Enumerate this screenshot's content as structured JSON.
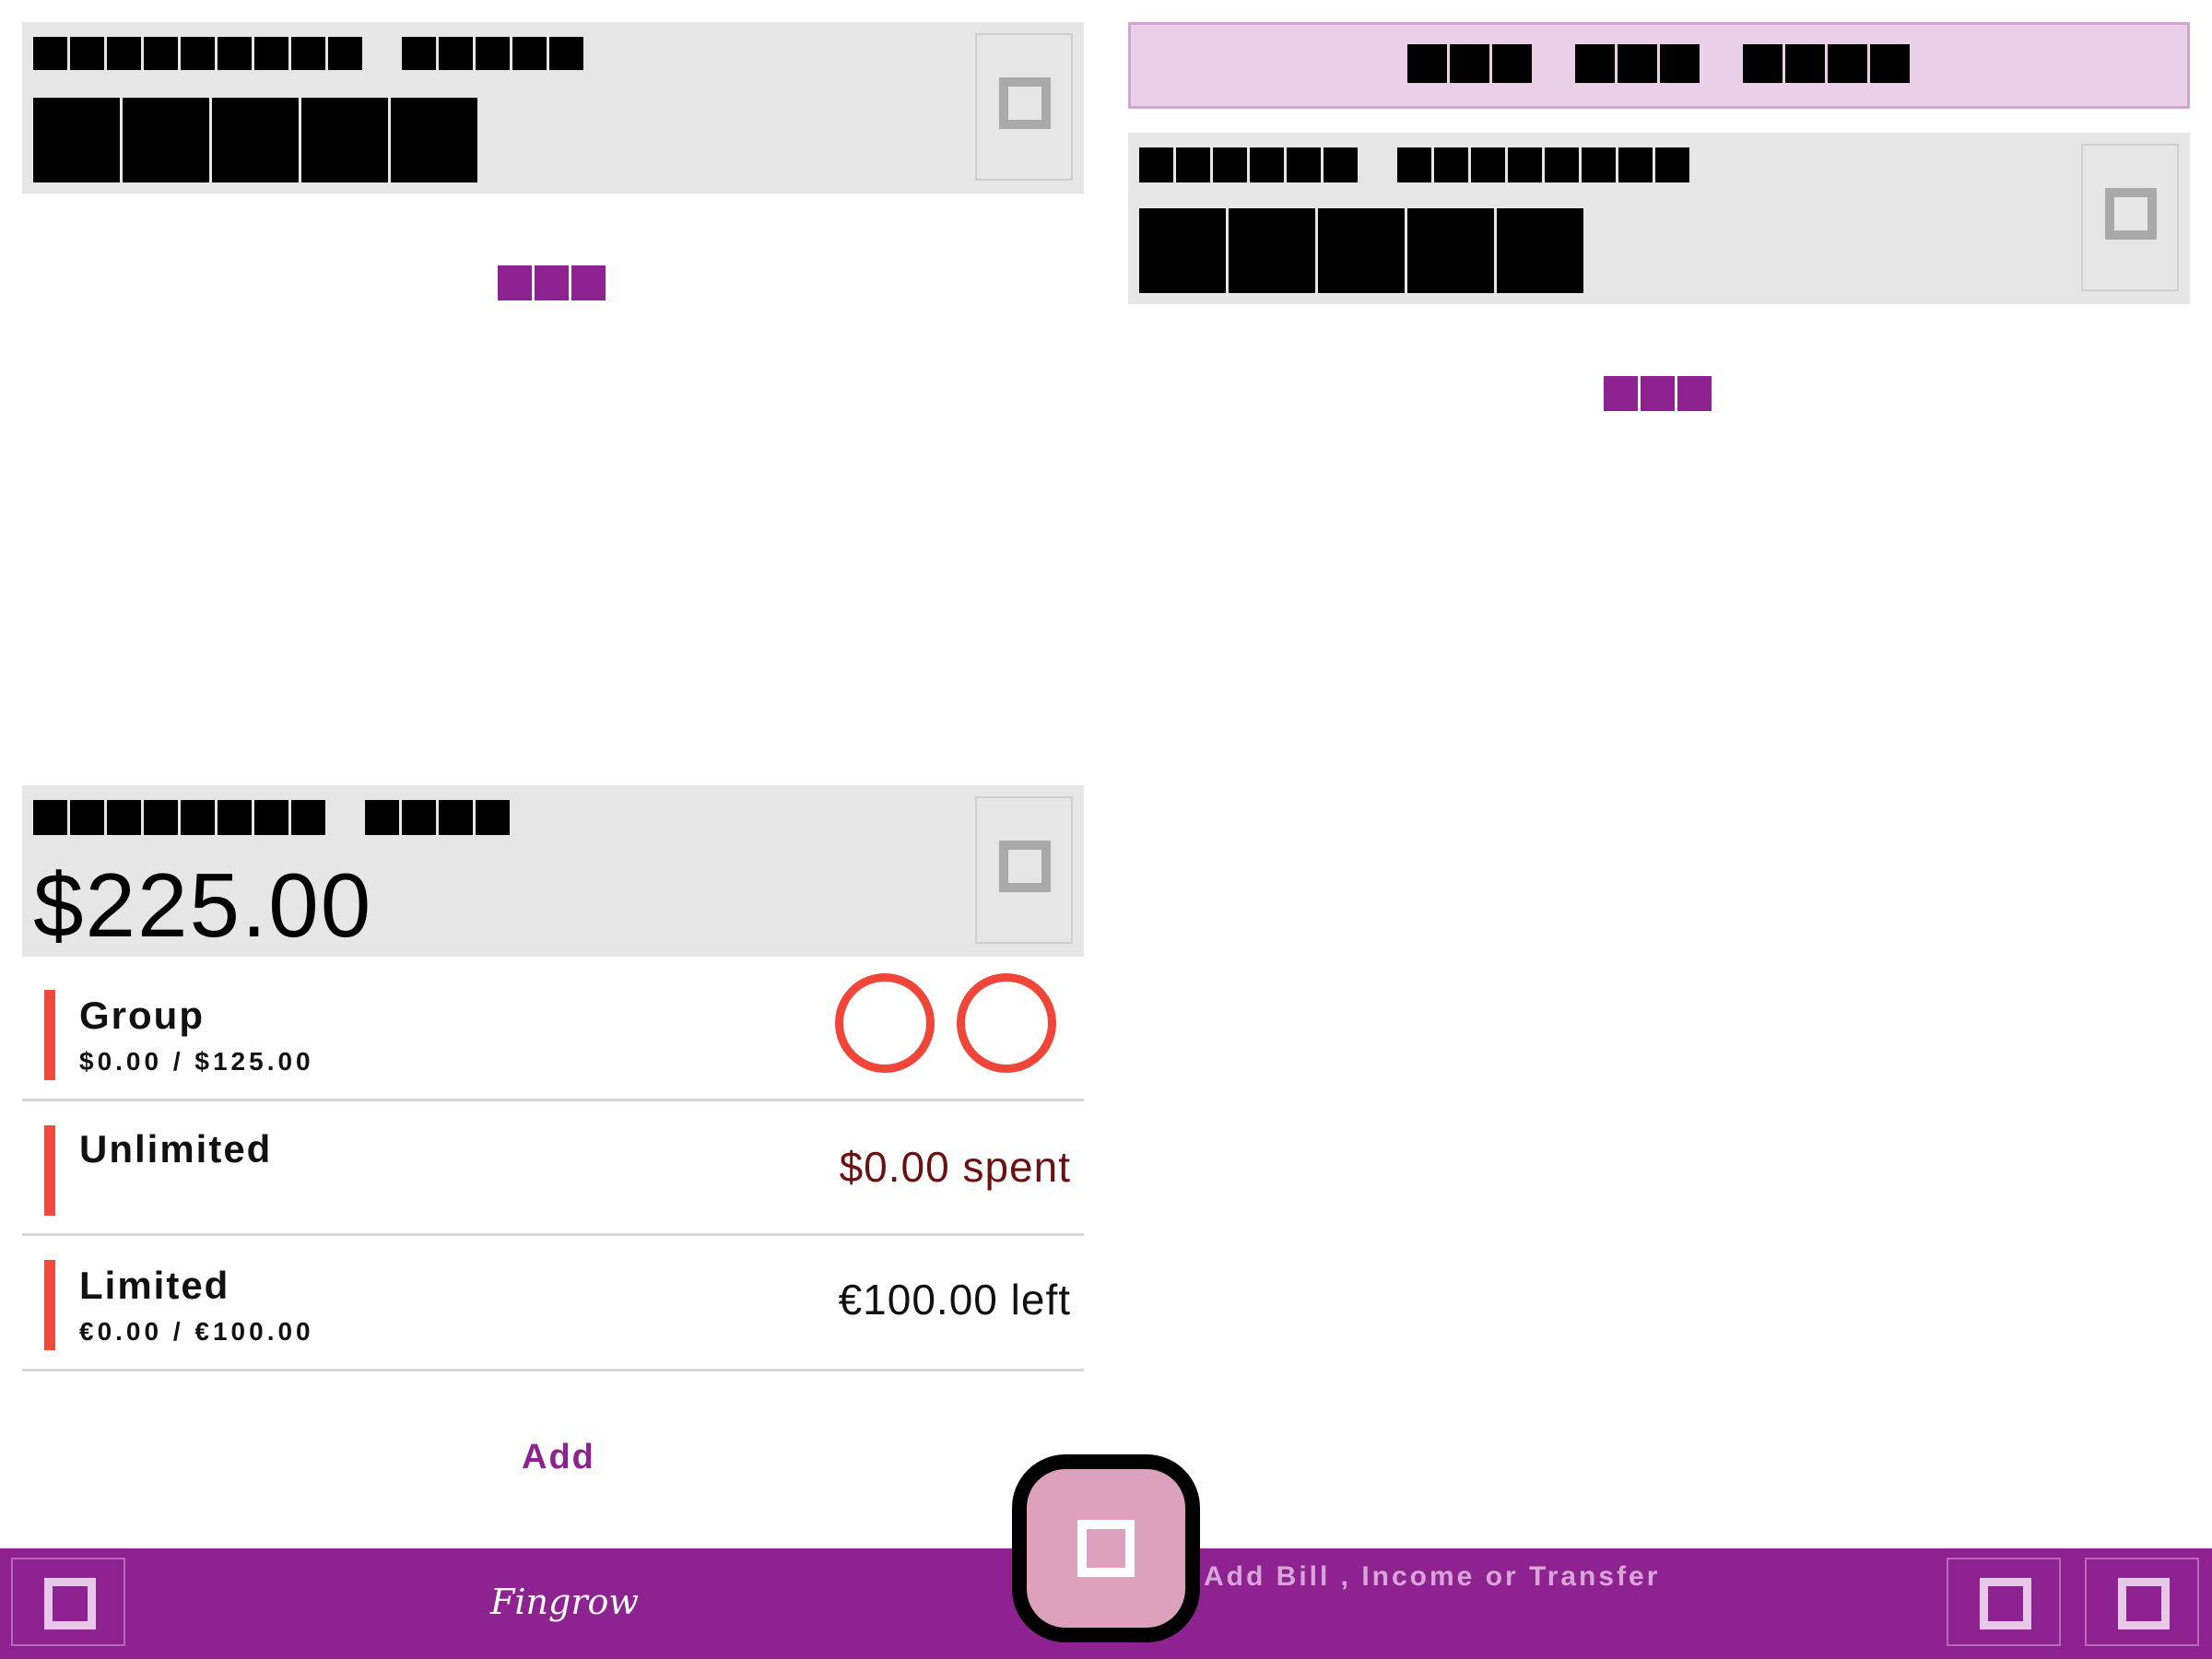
{
  "app": {
    "colors": {
      "accent": "#8e2290",
      "danger": "#ee4b3d",
      "spent": "#6b1111"
    }
  },
  "budget": {
    "amount": "$225.00",
    "items": [
      {
        "name": "Group",
        "detail": "$0.00 / $125.00",
        "status_icons": [
          "ring-icon",
          "ring-icon"
        ]
      },
      {
        "name": "Unlimited",
        "detail": "",
        "right": "$0.00 spent"
      },
      {
        "name": "Limited",
        "detail": "€0.00 / €100.00",
        "right": "€100.00 left"
      }
    ],
    "add_label": "Add"
  },
  "footer": {
    "logo": "Fingrow",
    "fab_label": "Add Bill , Income or Transfer",
    "icons": [
      "menu-icon",
      "nav-icon-1",
      "nav-icon-2",
      "add-icon"
    ]
  }
}
